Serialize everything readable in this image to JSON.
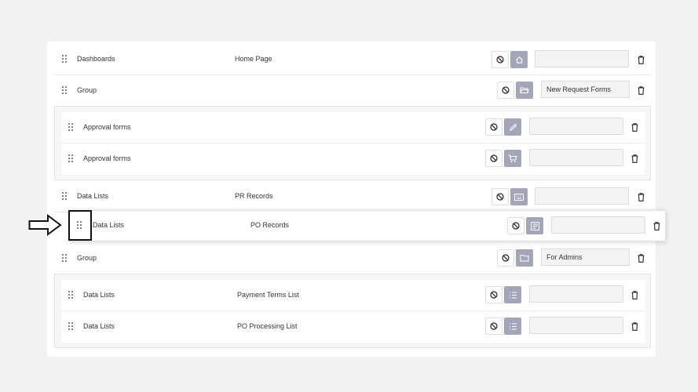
{
  "rows": [
    {
      "type": "Dashboards",
      "target": "Home Page",
      "icon": "home-icon",
      "field": ""
    },
    {
      "type": "Group",
      "target": "",
      "icon": "folder-open-icon",
      "field": "New Request Forms"
    },
    {
      "type": "Approval forms",
      "target": "",
      "icon": "pencil-icon",
      "field": ""
    },
    {
      "type": "Approval forms",
      "target": "",
      "icon": "cart-icon",
      "field": ""
    },
    {
      "type": "Data Lists",
      "target": "PR Records",
      "icon": "keyboard-icon",
      "field": ""
    },
    {
      "type": "Data Lists",
      "target": "PO Records",
      "icon": "list-box-icon",
      "field": ""
    },
    {
      "type": "Group",
      "target": "",
      "icon": "folder-icon",
      "field": "For Admins"
    },
    {
      "type": "Data Lists",
      "target": "Payment Terms List",
      "icon": "list-icon",
      "field": ""
    },
    {
      "type": "Data Lists",
      "target": "PO Processing List",
      "icon": "list-icon",
      "field": ""
    }
  ],
  "colors": {
    "accent": "#a2a6b8",
    "background": "#f2f2f2",
    "panel": "#ffffff"
  }
}
